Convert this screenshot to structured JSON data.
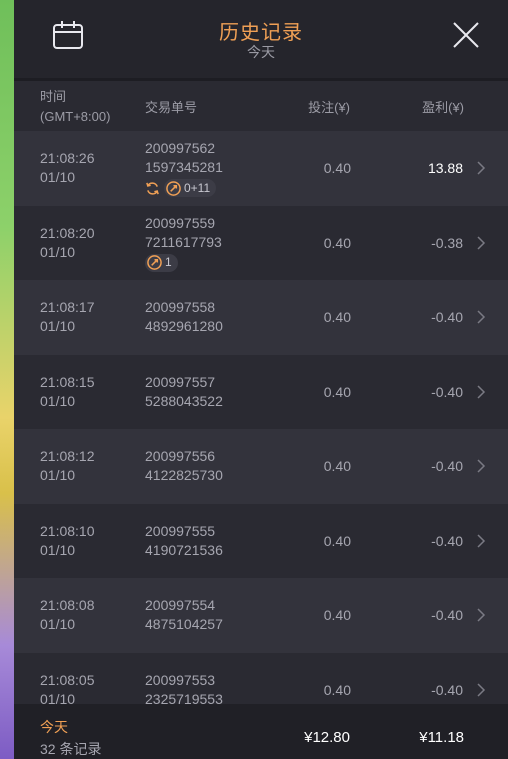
{
  "header": {
    "title": "历史记录",
    "subtitle": "今天",
    "calendar_icon": "calendar-icon",
    "close_icon": "close-icon"
  },
  "columns": {
    "time_line1": "时间",
    "time_line2": "(GMT+8:00)",
    "id": "交易单号",
    "bet": "投注(¥)",
    "profit": "盈利(¥)"
  },
  "rows": [
    {
      "time": "21:08:26",
      "date": "01/10",
      "id1": "200997562",
      "id2": "1597345281",
      "bet": "0.40",
      "profit": "13.88",
      "badges": {
        "respin": true,
        "label": "0+11"
      }
    },
    {
      "time": "21:08:20",
      "date": "01/10",
      "id1": "200997559",
      "id2": "7211617793",
      "bet": "0.40",
      "profit": "-0.38",
      "badges": {
        "respin": false,
        "label": "1"
      }
    },
    {
      "time": "21:08:17",
      "date": "01/10",
      "id1": "200997558",
      "id2": "4892961280",
      "bet": "0.40",
      "profit": "-0.40"
    },
    {
      "time": "21:08:15",
      "date": "01/10",
      "id1": "200997557",
      "id2": "5288043522",
      "bet": "0.40",
      "profit": "-0.40"
    },
    {
      "time": "21:08:12",
      "date": "01/10",
      "id1": "200997556",
      "id2": "4122825730",
      "bet": "0.40",
      "profit": "-0.40"
    },
    {
      "time": "21:08:10",
      "date": "01/10",
      "id1": "200997555",
      "id2": "4190721536",
      "bet": "0.40",
      "profit": "-0.40"
    },
    {
      "time": "21:08:08",
      "date": "01/10",
      "id1": "200997554",
      "id2": "4875104257",
      "bet": "0.40",
      "profit": "-0.40"
    },
    {
      "time": "21:08:05",
      "date": "01/10",
      "id1": "200997553",
      "id2": "2325719553",
      "bet": "0.40",
      "profit": "-0.40"
    }
  ],
  "footer": {
    "today": "今天",
    "count": "32 条记录",
    "bet_total": "¥12.80",
    "profit_total": "¥11.18"
  },
  "colors": {
    "accent": "#f0a055",
    "panel_bg": "#2a2a32",
    "row_alt_bg": "#33333c"
  }
}
